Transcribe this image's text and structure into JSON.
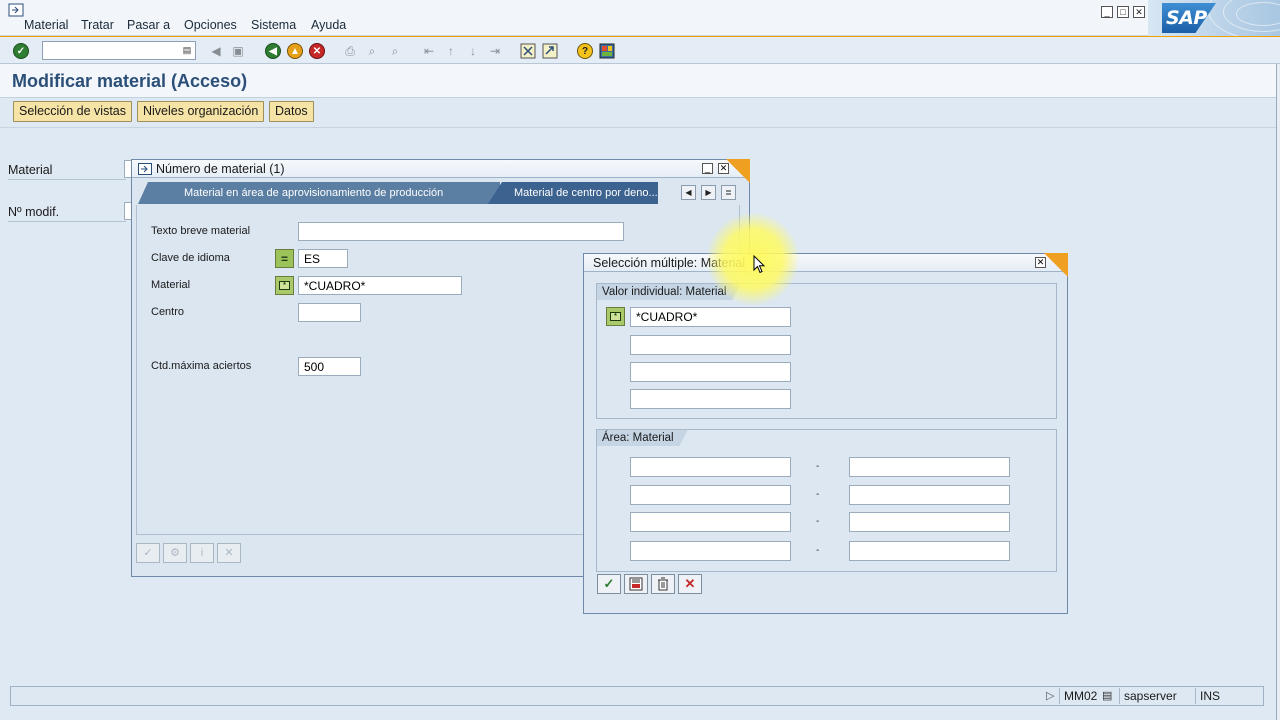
{
  "menu": {
    "items": [
      "Material",
      "Tratar",
      "Pasar a",
      "Opciones",
      "Sistema",
      "Ayuda"
    ],
    "logo_text": "SAP"
  },
  "toolbar": {
    "command_field": ""
  },
  "page": {
    "title": "Modificar material (Acceso)"
  },
  "app_toolbar": {
    "buttons": [
      "Selección de vistas",
      "Niveles organización",
      "Datos"
    ]
  },
  "main_form": {
    "material_label": "Material",
    "change_number_label": "Nº modif."
  },
  "dialog1": {
    "title": "Número de material (1)",
    "tabs": [
      "Material en área de aprovisionamiento de producción",
      "Material de centro por deno..."
    ],
    "fields": {
      "short_text_label": "Texto breve material",
      "short_text_value": "",
      "language_label": "Clave de idioma",
      "language_value": "ES",
      "material_label": "Material",
      "material_value": "*CUADRO*",
      "plant_label": "Centro",
      "plant_value": "",
      "max_hits_label": "Ctd.máxima aciertos",
      "max_hits_value": "500"
    }
  },
  "dialog2": {
    "title": "Selección múltiple: Material",
    "single_values_header": "Valor individual: Material",
    "single_values": [
      "*CUADRO*",
      "",
      "",
      ""
    ],
    "ranges_header": "Área: Material",
    "ranges": [
      {
        "from": "",
        "to": ""
      },
      {
        "from": "",
        "to": ""
      },
      {
        "from": "",
        "to": ""
      },
      {
        "from": "",
        "to": ""
      }
    ],
    "range_separator": "-"
  },
  "status_bar": {
    "transaction": "MM02",
    "server": "sapserver",
    "mode": "INS"
  },
  "colors": {
    "accent_orange": "#f0a020",
    "title_blue": "#2b4f78",
    "button_yellow": "#f6e4a6"
  }
}
